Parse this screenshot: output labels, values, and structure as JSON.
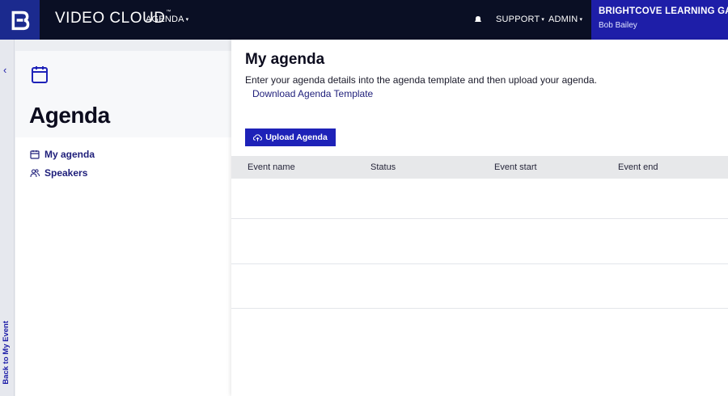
{
  "topbar": {
    "product_name": "VIDEO CLOUD",
    "trademark": "™",
    "nav": [
      {
        "label": "AGENDA",
        "caret": "▾"
      },
      {
        "label": "SUPPORT",
        "caret": "▾"
      },
      {
        "label": "ADMIN",
        "caret": "▾"
      }
    ],
    "account_name": "BRIGHTCOVE LEARNING GALL",
    "user_name": "Bob Bailey"
  },
  "rail": {
    "chevron": "‹",
    "back_label": "Back to My Event"
  },
  "panel": {
    "title": "Agenda",
    "items": [
      {
        "label": "My agenda",
        "icon": "calendar-icon"
      },
      {
        "label": "Speakers",
        "icon": "people-icon"
      }
    ]
  },
  "main": {
    "title": "My agenda",
    "description": "Enter your agenda details into the agenda template and then upload your agenda.",
    "download_link": "Download Agenda Template",
    "upload_button": "Upload Agenda",
    "columns": [
      "Event name",
      "Status",
      "Event start",
      "Event end"
    ],
    "rows": [
      [],
      [],
      []
    ]
  },
  "colors": {
    "topbar_bg": "#0a0f24",
    "account_bg": "#1e1ea8",
    "accent_button": "#1e22b8",
    "link": "#1e1e7a"
  }
}
